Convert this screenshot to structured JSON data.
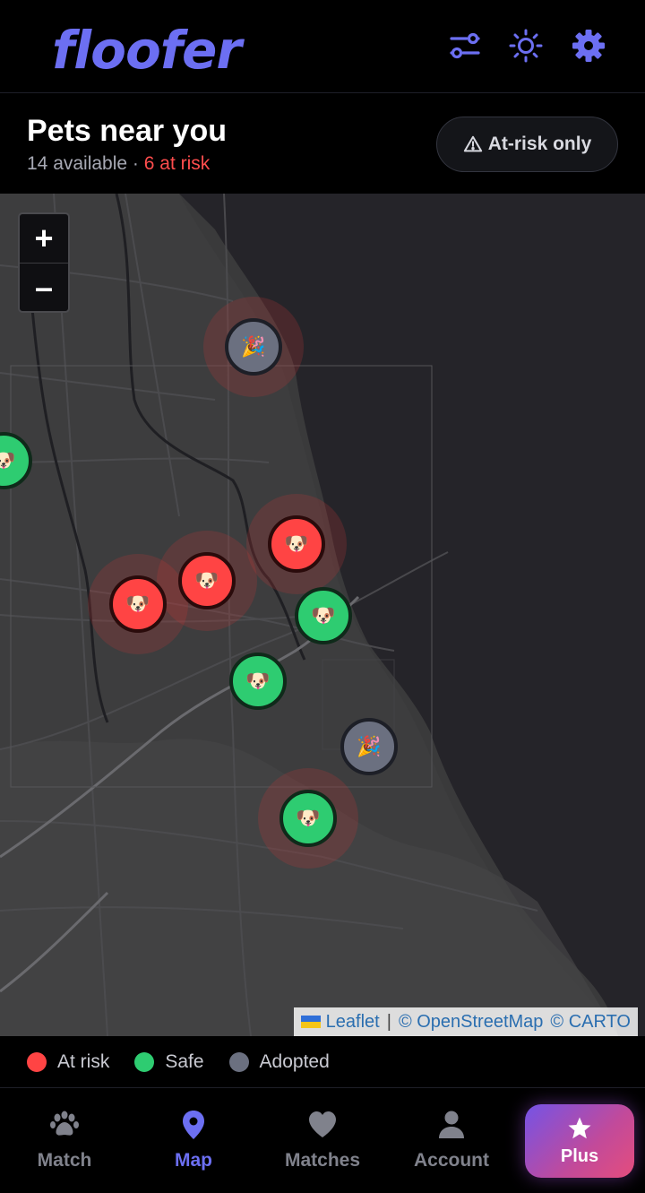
{
  "header": {
    "logo": "floofer",
    "icons": [
      "filters-icon",
      "theme-icon",
      "settings-icon"
    ]
  },
  "subheader": {
    "title": "Pets near you",
    "available": "14 available",
    "separator": " · ",
    "at_risk": "6 at risk",
    "toggle_label": "At-risk only"
  },
  "map": {
    "zoom_in": "+",
    "zoom_out": "–",
    "attribution": {
      "leaflet": "Leaflet",
      "osm": "© OpenStreetMap",
      "carto": "© CARTO"
    },
    "markers": [
      {
        "status": "adopted",
        "emoji": "🎉"
      },
      {
        "status": "safe",
        "emoji": "🐶"
      },
      {
        "status": "at-risk",
        "emoji": "🐶"
      },
      {
        "status": "at-risk",
        "emoji": "🐶"
      },
      {
        "status": "at-risk",
        "emoji": "🐶"
      },
      {
        "status": "safe",
        "emoji": "🐶"
      },
      {
        "status": "safe",
        "emoji": "🐶"
      },
      {
        "status": "adopted",
        "emoji": "🎉"
      },
      {
        "status": "safe",
        "emoji": "🐶"
      }
    ]
  },
  "legend": {
    "at_risk": "At risk",
    "safe": "Safe",
    "adopted": "Adopted"
  },
  "colors": {
    "accent": "#6c6ff2",
    "at_risk": "#ff4444",
    "safe": "#2ecc71",
    "adopted": "#6b7080"
  },
  "nav": {
    "match": "Match",
    "map": "Map",
    "matches": "Matches",
    "account": "Account",
    "plus": "Plus"
  }
}
